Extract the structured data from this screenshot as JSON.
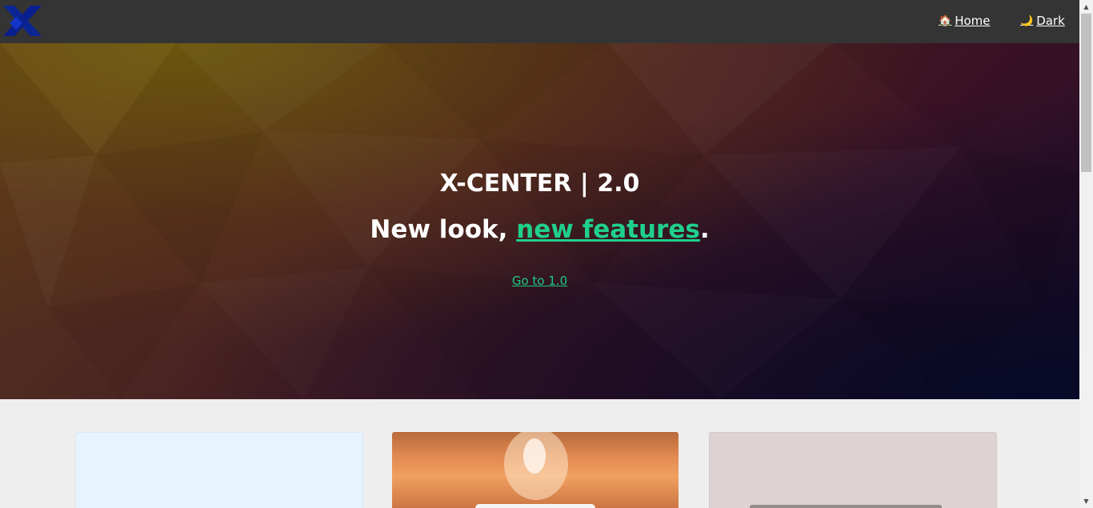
{
  "navbar": {
    "logo_icon": "x-logo-icon",
    "links": [
      {
        "icon": "house-icon",
        "glyph": "🏠",
        "label": "Home"
      },
      {
        "icon": "moon-icon",
        "glyph": "🌙",
        "label": "Dark"
      }
    ]
  },
  "hero": {
    "title": "X-CENTER | 2.0",
    "subtitle_prefix": "New look, ",
    "subtitle_link": "new features",
    "subtitle_suffix": ".",
    "back_link": "Go to 1.0"
  },
  "colors": {
    "navbar": "#343434",
    "accent": "#1fd08c",
    "page_background": "#efeeee",
    "logo": "#0a1f8f"
  }
}
